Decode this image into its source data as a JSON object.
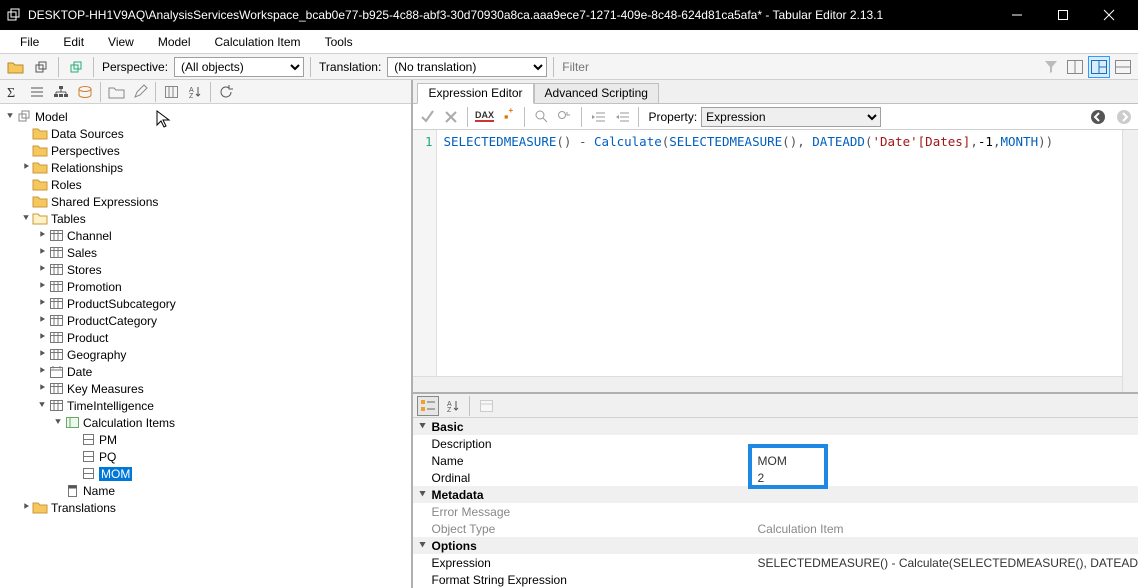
{
  "title": "DESKTOP-HH1V9AQ\\AnalysisServicesWorkspace_bcab0e77-b925-4c88-abf3-30d70930a8ca.aaa9ece7-1271-409e-8c48-624d81ca5afa* - Tabular Editor 2.13.1",
  "menu": [
    "File",
    "Edit",
    "View",
    "Model",
    "Calculation Item",
    "Tools"
  ],
  "toolbar1": {
    "perspective_label": "Perspective:",
    "perspective_value": "(All objects)",
    "translation_label": "Translation:",
    "translation_value": "(No translation)",
    "filter_placeholder": "Filter"
  },
  "tree": {
    "root": "Model",
    "folders": [
      "Data Sources",
      "Perspectives",
      "Relationships",
      "Roles",
      "Shared Expressions"
    ],
    "tables_label": "Tables",
    "tables": [
      "Channel",
      "Sales",
      "Stores",
      "Promotion",
      "ProductSubcategory",
      "ProductCategory",
      "Product",
      "Geography",
      "Date",
      "Key Measures"
    ],
    "ti": "TimeIntelligence",
    "calc_items_label": "Calculation Items",
    "calc_items": [
      "PM",
      "PQ",
      "MOM"
    ],
    "name_col": "Name",
    "translations": "Translations"
  },
  "tabs": {
    "expr": "Expression Editor",
    "script": "Advanced Scripting"
  },
  "editorbar": {
    "property_label": "Property:",
    "property_value": "Expression"
  },
  "code_tokens": {
    "sm": "SELECTEDMEASURE",
    "calc": "Calculate",
    "dateadd": "DATEADD",
    "dateref": "'Date'[Dates]",
    "neg1": "-1",
    "month": "MONTH"
  },
  "line_no": "1",
  "props": {
    "basic": "Basic",
    "description": "Description",
    "name": "Name",
    "name_val": "MOM",
    "ordinal": "Ordinal",
    "ordinal_val": "2",
    "metadata": "Metadata",
    "errmsg": "Error Message",
    "objtype": "Object Type",
    "objtype_val": "Calculation Item",
    "options": "Options",
    "expression": "Expression",
    "expression_val": "SELECTEDMEASURE() - Calculate(SELECTEDMEASURE(), DATEAD",
    "fse": "Format String Expression"
  }
}
